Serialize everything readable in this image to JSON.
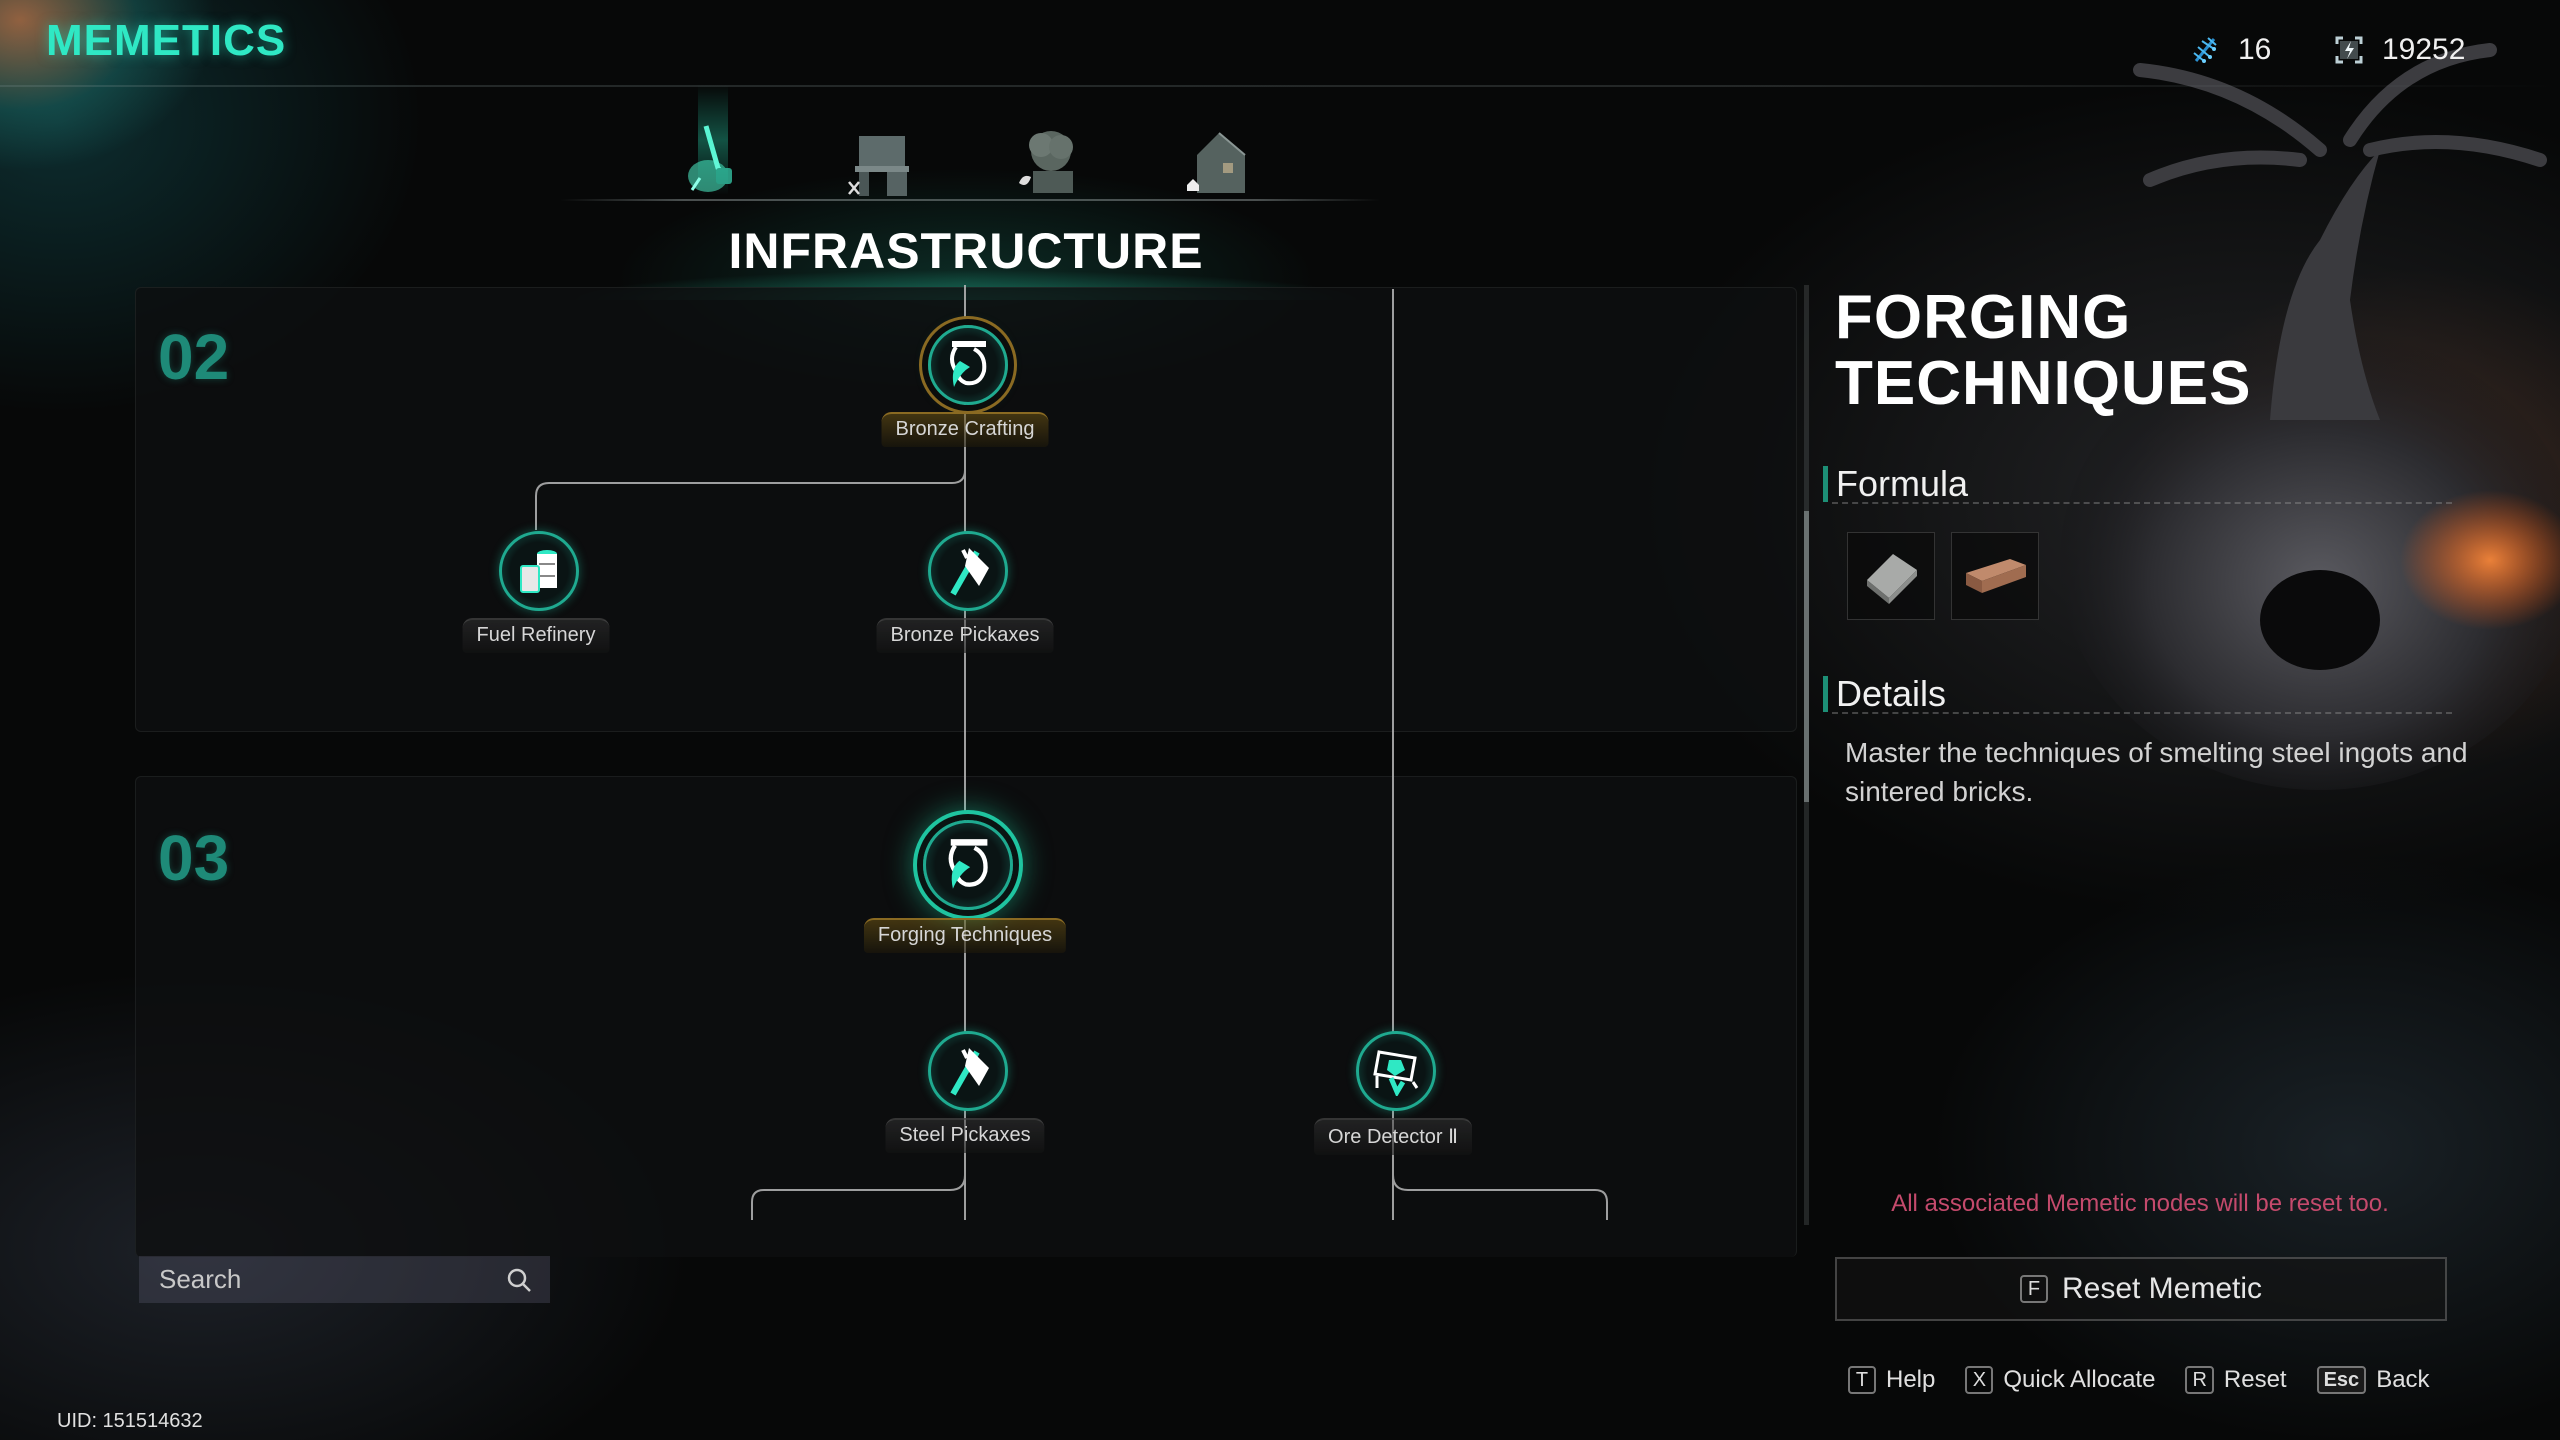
{
  "header": {
    "title": "MEMETICS",
    "resources": [
      {
        "icon": "dna-icon",
        "value": "16"
      },
      {
        "icon": "energy-chip-icon",
        "value": "19252"
      }
    ]
  },
  "tabs": [
    {
      "id": "chainsaw",
      "icon": "chainsaw-logs-icon",
      "active": true
    },
    {
      "id": "workbench",
      "icon": "workbench-icon",
      "active": false
    },
    {
      "id": "planter",
      "icon": "planter-icon",
      "active": false
    },
    {
      "id": "house",
      "icon": "house-icon",
      "active": false
    }
  ],
  "section_title": "INFRASTRUCTURE",
  "tiers": [
    {
      "label": "02"
    },
    {
      "label": "03"
    }
  ],
  "nodes": [
    {
      "id": "bronze-crafting",
      "label": "Bronze Crafting",
      "tier": "02",
      "icon": "crucible-icon",
      "state": "unlocked"
    },
    {
      "id": "fuel-refinery",
      "label": "Fuel Refinery",
      "tier": "02",
      "icon": "fuel-barrel-icon",
      "state": "available"
    },
    {
      "id": "bronze-pickaxes",
      "label": "Bronze Pickaxes",
      "tier": "02",
      "icon": "pickaxe-icon",
      "state": "available"
    },
    {
      "id": "forging-techniques",
      "label": "Forging Techniques",
      "tier": "03",
      "icon": "crucible-icon",
      "state": "selected"
    },
    {
      "id": "steel-pickaxes",
      "label": "Steel Pickaxes",
      "tier": "03",
      "icon": "pickaxe-icon",
      "state": "available"
    },
    {
      "id": "ore-detector-2",
      "label": "Ore Detector Ⅱ",
      "tier": "03",
      "icon": "ore-detector-icon",
      "state": "available"
    }
  ],
  "scroll": {
    "thumb_start_fraction": 0.24,
    "thumb_size_fraction": 0.31
  },
  "details": {
    "title_line1": "FORGING",
    "title_line2": "TECHNIQUES",
    "formula_heading": "Formula",
    "formula_items": [
      {
        "name": "Steel Ingot",
        "icon": "steel-ingot-icon"
      },
      {
        "name": "Sintered Brick",
        "icon": "brick-icon"
      }
    ],
    "details_heading": "Details",
    "description": "Master the techniques of smelting steel ingots and sintered bricks.",
    "warning": "All associated Memetic nodes will be reset too.",
    "reset_key": "F",
    "reset_label": "Reset Memetic"
  },
  "hints": [
    {
      "key": "T",
      "label": "Help"
    },
    {
      "key": "X",
      "label": "Quick Allocate"
    },
    {
      "key": "R",
      "label": "Reset"
    },
    {
      "key": "Esc",
      "label": "Back"
    }
  ],
  "search": {
    "placeholder": "Search",
    "value": ""
  },
  "uid": "UID: 151514632",
  "colors": {
    "accent": "#2fe8c4",
    "tier": "#1e8a78",
    "warning": "#c44a6c",
    "gold": "#8a6a22"
  }
}
